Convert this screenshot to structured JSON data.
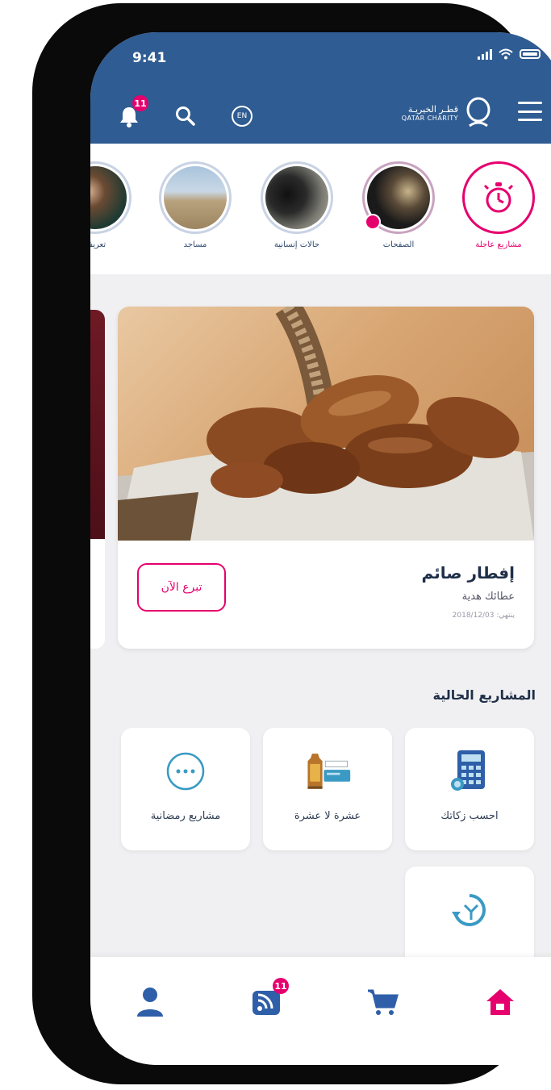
{
  "status_bar": {
    "time": "9:41"
  },
  "header": {
    "notifications_badge": "11",
    "language_label": "EN",
    "logo_arabic": "قطـر الخيريـة",
    "logo_english": "QATAR CHARITY"
  },
  "stories": [
    {
      "label": "مشاريع عاجلة",
      "icon": "alarm-clock-icon"
    },
    {
      "label": "الصفحات",
      "icon": "pages-photo"
    },
    {
      "label": "حالات إنسانية",
      "icon": "humanitarian-photo"
    },
    {
      "label": "مساجد",
      "icon": "mosque-photo"
    },
    {
      "label": "تعريف",
      "icon": "intro-photo"
    }
  ],
  "featured_card": {
    "title": "إفطار صائم",
    "subtitle": "عطائك هدية",
    "date": "ينتهي: 2018/12/03",
    "donate_label": "تبرع الآن"
  },
  "current_projects": {
    "title": "المشاريع الحالية",
    "tiles": [
      {
        "label": "احسب زكاتك",
        "icon": "calculator-icon"
      },
      {
        "label": "عشرة لا عشرة",
        "icon": "ramadan-lantern-icon"
      },
      {
        "label": "مشاريع رمضانية",
        "icon": "more-dots-icon"
      },
      {
        "label": "",
        "icon": "recurring-donation-icon"
      }
    ]
  },
  "bottom_nav": {
    "messages_badge": "11",
    "items": [
      "home-icon",
      "cart-icon",
      "news-icon",
      "profile-icon"
    ]
  },
  "colors": {
    "header_blue": "#2f5c92",
    "accent_pink": "#e6006e",
    "icon_blue": "#2e5fa8",
    "teal": "#3a9ac4"
  }
}
